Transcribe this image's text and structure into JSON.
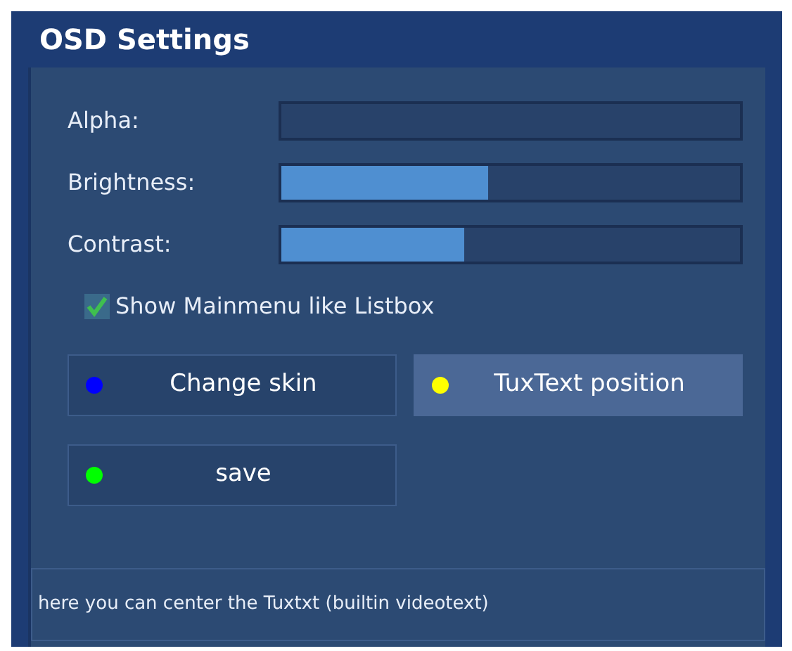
{
  "window": {
    "title": "OSD Settings"
  },
  "sliders": [
    {
      "label": "Alpha:"
    },
    {
      "label": "Brightness:",
      "level": 0.45
    },
    {
      "label": "Contrast:",
      "level": 0.4
    }
  ],
  "checkbox": {
    "label": "Show Mainmenu like Listbox",
    "checked": true
  },
  "buttons": [
    {
      "label": "Change skin",
      "color": "#0000ff",
      "selected": false
    },
    {
      "label": "TuxText position",
      "color": "#ffff00",
      "selected": true
    },
    {
      "label": "save",
      "color": "#00ff00",
      "selected": false
    }
  ],
  "status_bar": "here you can center the Tuxtxt (builtin videotext)"
}
